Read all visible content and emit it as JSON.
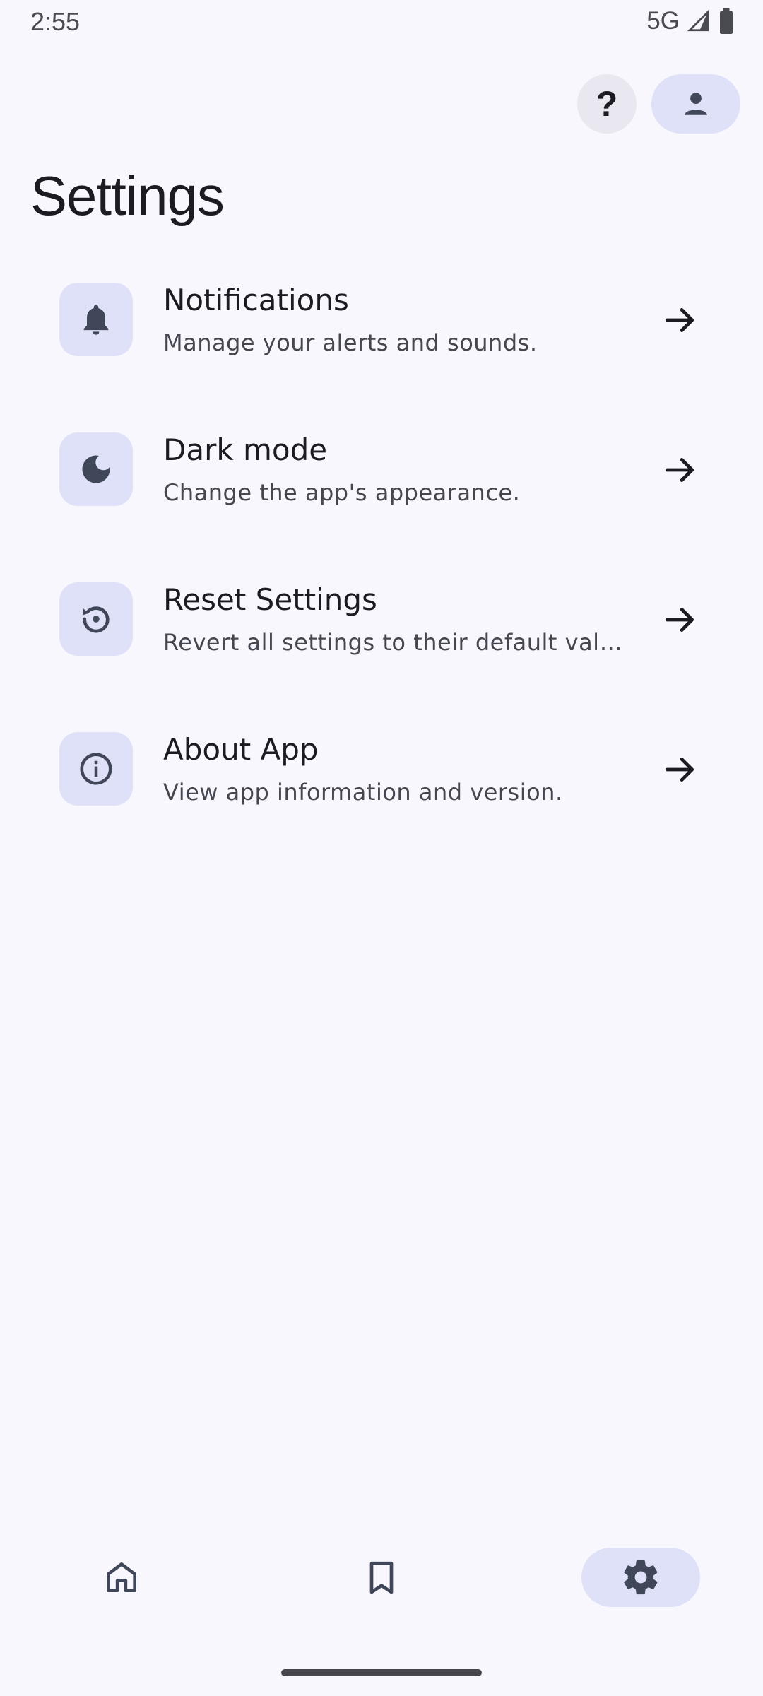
{
  "status_bar": {
    "time": "2:55",
    "network": "5G"
  },
  "header": {
    "title": "Settings"
  },
  "settings": [
    {
      "title": "Notifications",
      "subtitle": "Manage your alerts and sounds.",
      "icon": "bell-icon"
    },
    {
      "title": "Dark mode",
      "subtitle": "Change the app's appearance.",
      "icon": "moon-icon"
    },
    {
      "title": "Reset Settings",
      "subtitle": "Revert all settings to their default valu…",
      "icon": "reset-icon"
    },
    {
      "title": "About App",
      "subtitle": "View app information and version.",
      "icon": "info-icon"
    }
  ],
  "top_actions": {
    "help_label": "?"
  },
  "bottom_nav": {
    "items": [
      "home-icon",
      "bookmark-icon",
      "gear-icon"
    ],
    "selected": "gear-icon"
  },
  "colors": {
    "background": "#f8f7fe",
    "tonal": "#dee1f7",
    "icon": "#3f4759",
    "text": "#1b1b21"
  }
}
